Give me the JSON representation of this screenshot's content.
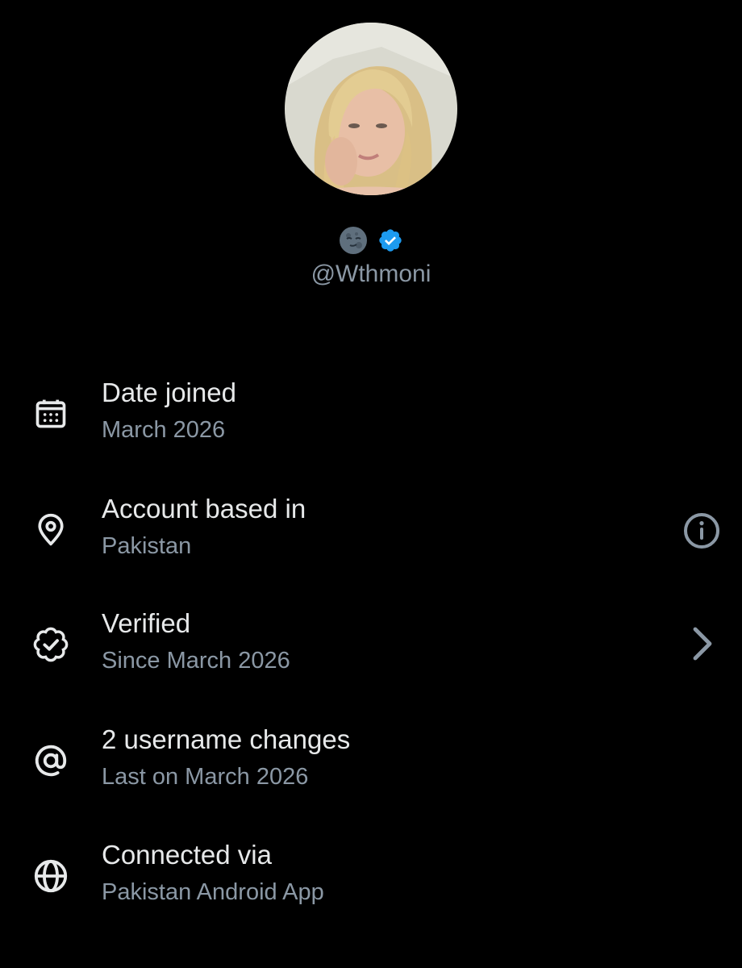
{
  "profile": {
    "handle": "@Wthmoni",
    "avatar_description": "profile-photo",
    "name_emoji": "new-moon-face-emoji",
    "verified_badge_color": "#1d9bf0"
  },
  "about": {
    "items": [
      {
        "icon": "calendar-icon",
        "title": "Date joined",
        "subtitle": "March 2026",
        "action": ""
      },
      {
        "icon": "location-pin-icon",
        "title": "Account based in",
        "subtitle": "Pakistan",
        "action": "info-icon"
      },
      {
        "icon": "verified-seal-icon",
        "title": "Verified",
        "subtitle": "Since March 2026",
        "action": "chevron-right-icon"
      },
      {
        "icon": "at-sign-icon",
        "title": "2 username changes",
        "subtitle": "Last on March 2026",
        "action": ""
      },
      {
        "icon": "globe-icon",
        "title": "Connected via",
        "subtitle": "Pakistan Android App",
        "action": ""
      }
    ]
  },
  "colors": {
    "background": "#000000",
    "primary_text": "#e7e9ea",
    "secondary_text": "#8b98a5",
    "accent": "#1d9bf0"
  }
}
